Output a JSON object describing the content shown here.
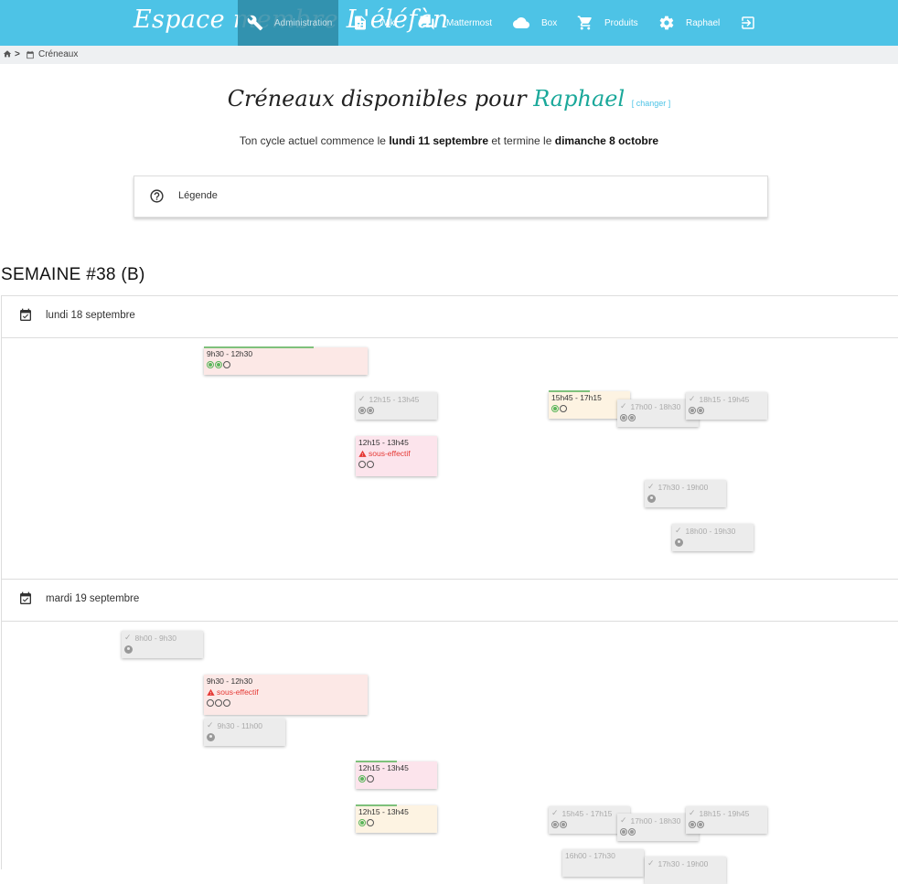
{
  "nav": {
    "brand": "Espace membre L'éléfàn",
    "items": [
      {
        "label": "Administration",
        "icon": "wrench-icon"
      },
      {
        "label": "Wiki",
        "icon": "document-icon"
      },
      {
        "label": "Mattermost",
        "icon": "chat-icon"
      },
      {
        "label": "Box",
        "icon": "cloud-icon"
      },
      {
        "label": "Produits",
        "icon": "cart-icon"
      },
      {
        "label": "Raphael",
        "icon": "gear-icon"
      },
      {
        "label": "",
        "icon": "logout-icon"
      }
    ]
  },
  "breadcrumb": {
    "home_icon": "home-icon",
    "separator": ">",
    "current": "Créneaux"
  },
  "page": {
    "title_prefix": "Créneaux disponibles pour",
    "user": "Raphael",
    "change_link": "[ changer ]",
    "cycle_prefix": "Ton cycle actuel commence le",
    "cycle_start": "lundi 11 septembre",
    "cycle_mid": "et termine le",
    "cycle_end": "dimanche 8 octobre"
  },
  "legend": {
    "label": "Légende"
  },
  "week": {
    "title": "SEMAINE #38 (B)"
  },
  "days": [
    {
      "label": "lundi 18 septembre",
      "slots": [
        {
          "time": "9h30 - 12h30",
          "style": "pink",
          "circles": [
            "f",
            "f",
            "e"
          ],
          "bar": 0.67
        },
        {
          "time": "12h15 - 13h45",
          "style": "grey",
          "check": true,
          "circles": [
            "g",
            "g"
          ]
        },
        {
          "time": "12h15 - 13h45",
          "style": "pinker",
          "warning": "sous-effectif",
          "circles": [
            "e",
            "e"
          ]
        },
        {
          "time": "15h45 - 17h15",
          "style": "cream",
          "circles": [
            "f",
            "e"
          ],
          "bar": 0.5
        },
        {
          "time": "17h00 - 18h30",
          "style": "grey",
          "check": true,
          "circles": [
            "g",
            "g"
          ]
        },
        {
          "time": "18h15 - 19h45",
          "style": "grey",
          "check": true,
          "circles": [
            "g",
            "g"
          ]
        },
        {
          "time": "17h30 - 19h00",
          "style": "grey",
          "check": true,
          "avatar": true
        },
        {
          "time": "18h00 - 19h30",
          "style": "grey",
          "check": true,
          "avatar": true
        }
      ]
    },
    {
      "label": "mardi 19 septembre",
      "slots": [
        {
          "time": "8h00 - 9h30",
          "style": "grey",
          "check": true,
          "avatar": true
        },
        {
          "time": "9h30 - 12h30",
          "style": "pink",
          "warning": "sous-effectif",
          "circles": [
            "e",
            "e",
            "e"
          ]
        },
        {
          "time": "9h30 - 11h00",
          "style": "grey",
          "check": true,
          "avatar": true
        },
        {
          "time": "12h15 - 13h45",
          "style": "pinker",
          "circles": [
            "f",
            "e"
          ],
          "bar": 0.5
        },
        {
          "time": "12h15 - 13h45",
          "style": "cream",
          "circles": [
            "f",
            "e"
          ],
          "bar": 0.5
        },
        {
          "time": "15h45 - 17h15",
          "style": "grey",
          "check": true,
          "circles": [
            "g",
            "g"
          ]
        },
        {
          "time": "17h00 - 18h30",
          "style": "grey",
          "check": true,
          "circles": [
            "g",
            "g"
          ]
        },
        {
          "time": "18h15 - 19h45",
          "style": "grey",
          "check": true,
          "circles": [
            "g",
            "g"
          ]
        },
        {
          "time": "16h00 - 17h30",
          "style": "grey",
          "check": false,
          "circles": []
        },
        {
          "time": "17h30 - 19h00",
          "style": "grey",
          "check": true,
          "circles": []
        }
      ]
    }
  ]
}
